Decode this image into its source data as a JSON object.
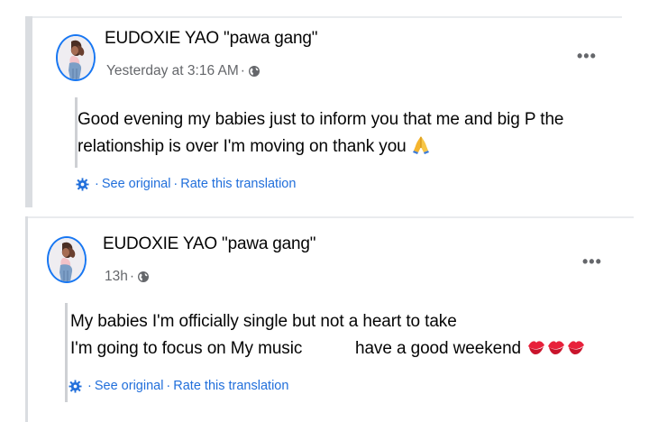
{
  "posts": [
    {
      "author": "EUDOXIE YAO \"pawa gang\"",
      "timestamp": "Yesterday at 3:16 AM",
      "separator": "·",
      "privacy_icon": "globe-icon",
      "more_label": "•••",
      "text_lines": [
        "Good evening my babies just to inform you that me and big P the",
        "relationship is over I'm moving on thank you"
      ],
      "emoji": "folded-hands-emoji",
      "see_original": "See original",
      "rate_translation": "Rate this translation"
    },
    {
      "author": "EUDOXIE YAO \"pawa gang\"",
      "timestamp": "13h",
      "separator": "·",
      "privacy_icon": "globe-icon",
      "more_label": "•••",
      "text_lines": [
        "My babies I'm officially single but not a heart to take",
        "I'm going to focus on My music",
        "have a good weekend"
      ],
      "emoji": "kiss-mark-emoji",
      "see_original": "See original",
      "rate_translation": "Rate this translation"
    }
  ],
  "colors": {
    "link_blue": "#216fdb",
    "meta_gray": "#65676b",
    "avatar_ring": "#1877f2",
    "kiss_red": "#e8213b"
  }
}
